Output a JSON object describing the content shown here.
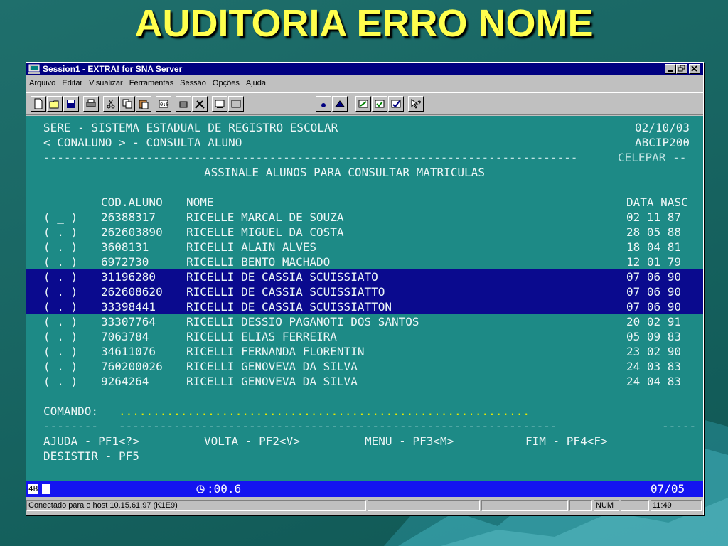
{
  "slide": {
    "title": "AUDITORIA ERRO NOME"
  },
  "window": {
    "title": "Session1 - EXTRA! for SNA Server",
    "controls": {
      "minimize": "_",
      "restore": "̲❐",
      "close": "✕"
    },
    "menu": [
      "Arquivo",
      "Editar",
      "Visualizar",
      "Ferramentas",
      "Sessão",
      "Opções",
      "Ajuda"
    ]
  },
  "screen": {
    "header": {
      "line1_left": "SERE - SISTEMA ESTADUAL DE REGISTRO ESCOLAR",
      "line1_right": "02/10/03",
      "line2_left": "< CONALUNO > - CONSULTA ALUNO",
      "line2_right": "ABCIP200",
      "line3_left": "------------------------------------------------------------------------------",
      "line3_right": "CELEPAR --",
      "subtitle": "ASSINALE ALUNOS PARA CONSULTAR MATRICULAS"
    },
    "columns": {
      "code": "COD.ALUNO",
      "name": "NOME",
      "date": "DATA NASC"
    },
    "rows": [
      {
        "sel": "( _ )",
        "code": "26388317",
        "name": "RICELLE MARCAL DE SOUZA",
        "date": "02 11 87",
        "highlight": false
      },
      {
        "sel": "( . )",
        "code": "262603890",
        "name": "RICELLE MIGUEL DA COSTA",
        "date": "28 05 88",
        "highlight": false
      },
      {
        "sel": "( . )",
        "code": "3608131",
        "name": "RICELLI ALAIN ALVES",
        "date": "18 04 81",
        "highlight": false
      },
      {
        "sel": "( . )",
        "code": "6972730",
        "name": "RICELLI BENTO MACHADO",
        "date": "12 01 79",
        "highlight": false
      },
      {
        "sel": "( . )",
        "code": "31196280",
        "name": "RICELLI DE CASSIA SCUISSIATO",
        "date": "07 06 90",
        "highlight": true
      },
      {
        "sel": "( . )",
        "code": "262608620",
        "name": "RICELLI DE CASSIA SCUISSIATTO",
        "date": "07 06 90",
        "highlight": true
      },
      {
        "sel": "( . )",
        "code": "33398441",
        "name": "RICELLI DE CASSIA SCUISSIATTON",
        "date": "07 06 90",
        "highlight": true
      },
      {
        "sel": "( . )",
        "code": "33307764",
        "name": "RICELLI DESSIO PAGANOTI DOS SANTOS",
        "date": "20 02 91",
        "highlight": false
      },
      {
        "sel": "( . )",
        "code": "7063784",
        "name": "RICELLI ELIAS FERREIRA",
        "date": "05 09 83",
        "highlight": false
      },
      {
        "sel": "( . )",
        "code": "34611076",
        "name": "RICELLI FERNANDA FLORENTIN",
        "date": "23 02 90",
        "highlight": false
      },
      {
        "sel": "( . )",
        "code": "760200026",
        "name": "RICELLI GENOVEVA DA SILVA",
        "date": "24 03 83",
        "highlight": false
      },
      {
        "sel": "( . )",
        "code": "9264264",
        "name": "RICELLI GENOVEVA DA SILVA",
        "date": "24 04 83",
        "highlight": false
      }
    ],
    "command": {
      "label": "COMANDO:",
      "dots": "............................................................"
    },
    "footer_sep_left": "--------",
    "footer_sep_mid": "----------------------------------------------------------------",
    "footer_sep_right": "-----",
    "pf_keys": {
      "help": "AJUDA - PF1<?>",
      "back": "VOLTA - PF2<V>",
      "menu": "MENU - PF3<M>",
      "end": "FIM - PF4<F>",
      "quit": "DESISTIR - PF5"
    }
  },
  "oia": {
    "left": "4B",
    "timer": ":00.6",
    "cursor": "07/05"
  },
  "statusbar": {
    "connection": "Conectado para o host 10.15.61.97 (K1E9)",
    "num": "NUM",
    "time": "11:49"
  },
  "colors": {
    "title": "#ffff4d",
    "screen_bg": "#1d8a86",
    "highlight": "#0a0a8e",
    "oia_bg": "#1414f0",
    "titlebar": "#000080"
  }
}
